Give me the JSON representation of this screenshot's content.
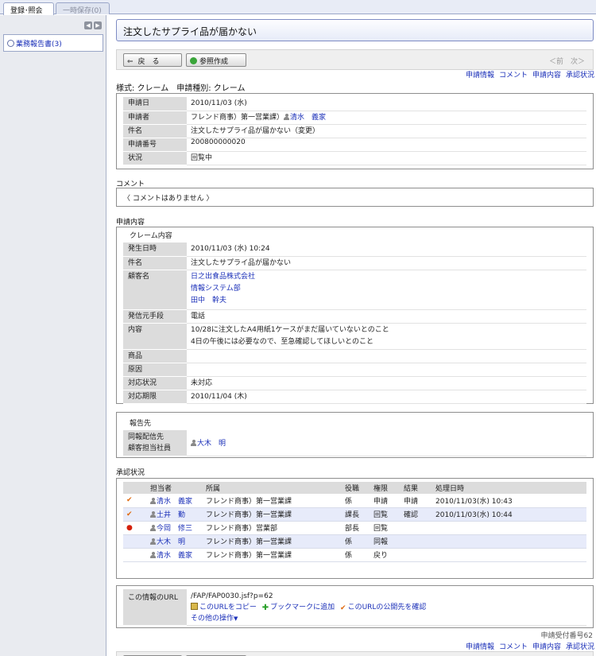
{
  "tabs": {
    "active": "登録･照会",
    "inactive": "一時保存(0)"
  },
  "sidebar": {
    "item": "業務報告書(3)"
  },
  "title": "注文したサプライ品が届かない",
  "toolbar": {
    "back": "戻　る",
    "ref": "参照作成",
    "pager": "＜前　次＞"
  },
  "quicklinks": [
    "申請情報",
    "コメント",
    "申請内容",
    "承認状況"
  ],
  "form_type": "様式: クレーム　申請種別: クレーム",
  "app_info": [
    {
      "label": "申請日",
      "value": "2010/11/03 (水)"
    },
    {
      "label": "申請者",
      "value": "フレンド商事）第一営業課）",
      "link": "清水　義家"
    },
    {
      "label": "件名",
      "value": "注文したサプライ品が届かない（変更）"
    },
    {
      "label": "申請番号",
      "value": "200800000020"
    },
    {
      "label": "状況",
      "value": "回覧中"
    }
  ],
  "comment": {
    "title": "コメント",
    "text": "〈 コメントはありません 〉"
  },
  "content": {
    "title": "申請内容",
    "sub": "クレーム内容",
    "rows": [
      {
        "label": "発生日時",
        "value": "2010/11/03 (水) 10:24"
      },
      {
        "label": "件名",
        "value": "注文したサプライ品が届かない"
      },
      {
        "label": "顧客名",
        "lines": [
          "日之出食品株式会社",
          "情報システム部",
          "田中　幹夫"
        ],
        "link": true
      },
      {
        "label": "発信元手段",
        "value": "電話"
      },
      {
        "label": "内容",
        "lines": [
          "10/28に注文したA4用紙1ケースがまだ届いていないとのこと",
          "4日の午後には必要なので、至急確認してほしいとのこと"
        ]
      },
      {
        "label": "商品",
        "value": ""
      },
      {
        "label": "原因",
        "value": ""
      },
      {
        "label": "対応状況",
        "value": "未対応"
      },
      {
        "label": "対応期限",
        "value": "2010/11/04 (木)"
      }
    ]
  },
  "report": {
    "sub": "報告先",
    "label1": "同報配信先",
    "label2": "顧客担当社員",
    "person": "大木　明"
  },
  "approval": {
    "title": "承認状況",
    "headers": [
      "担当者",
      "所属",
      "役職",
      "権限",
      "結果",
      "処理日時"
    ],
    "rows": [
      {
        "mark": "✔",
        "name": "清水　義家",
        "dept": "フレンド商事）第一営業課",
        "post": "係",
        "auth": "申請",
        "result": "申請",
        "date": "2010/11/03(水) 10:43"
      },
      {
        "mark": "✔",
        "name": "土井　勤",
        "dept": "フレンド商事）第一営業課",
        "post": "課長",
        "auth": "回覧",
        "result": "確認",
        "date": "2010/11/03(水) 10:44"
      },
      {
        "mark": "●",
        "name": "今岡　修三",
        "dept": "フレンド商事）営業部",
        "post": "部長",
        "auth": "回覧",
        "result": "",
        "date": ""
      },
      {
        "mark": "",
        "name": "大木　明",
        "dept": "フレンド商事）第一営業課",
        "post": "係",
        "auth": "同報",
        "result": "",
        "date": ""
      },
      {
        "mark": "",
        "name": "清水　義家",
        "dept": "フレンド商事）第一営業課",
        "post": "係",
        "auth": "戻り",
        "result": "",
        "date": ""
      }
    ]
  },
  "info_url": {
    "label": "この情報のURL",
    "url": "/FAP/FAP0030.jsf?p=62",
    "copy": "このURLをコピー",
    "bookmark": "ブックマークに追加",
    "public": "このURLの公開先を確認",
    "other": "その他の操作"
  },
  "receipt_no": "申請受付番号62"
}
